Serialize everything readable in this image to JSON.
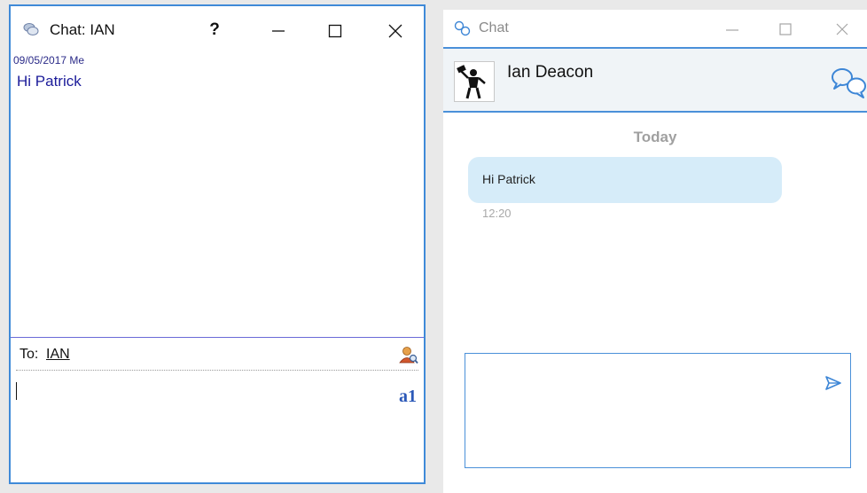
{
  "left_window": {
    "title": "Chat: IAN",
    "controls": {
      "help": "?",
      "minimize": "—",
      "maximize": "☐",
      "close": "✕"
    },
    "messages": [
      {
        "meta": "09/05/2017 Me",
        "text": "Hi Patrick"
      }
    ],
    "to_label": "To:",
    "to_value": "IAN",
    "icons": {
      "app": "chat-bubbles-icon",
      "contact": "contact-search-icon",
      "font": "font-icon"
    },
    "font_icon_text": "a1",
    "accent_color": "#3f8ad8"
  },
  "right_window": {
    "title": "Chat",
    "controls": {
      "minimize": "—",
      "maximize": "☐",
      "close": "✕"
    },
    "contact_name": "Ian Deacon",
    "day_label": "Today",
    "messages": [
      {
        "text": "Hi Patrick",
        "time": "12:20"
      }
    ],
    "icons": {
      "app": "chat-links-icon",
      "avatar": "avatar",
      "chat": "chat-bubbles-icon",
      "send": "send-icon"
    },
    "bubble_color": "#d6ecf9",
    "accent_color": "#4a90d9"
  }
}
